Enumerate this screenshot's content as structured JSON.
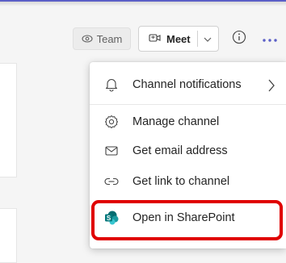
{
  "header": {
    "team_label": "Team",
    "meet_label": "Meet"
  },
  "menu": {
    "items": [
      {
        "label": "Channel notifications",
        "icon": "bell-icon",
        "has_submenu": true
      },
      {
        "label": "Manage channel",
        "icon": "gear-icon"
      },
      {
        "label": "Get email address",
        "icon": "mail-icon"
      },
      {
        "label": "Get link to channel",
        "icon": "link-icon"
      },
      {
        "label": "Open in SharePoint",
        "icon": "sharepoint-icon",
        "highlighted": true
      }
    ]
  },
  "colors": {
    "accent": "#5b5fc7",
    "highlight": "#e00000",
    "sharepoint_dark": "#036c70",
    "sharepoint_mid": "#1a9ba1",
    "sharepoint_light": "#37c6d0"
  }
}
